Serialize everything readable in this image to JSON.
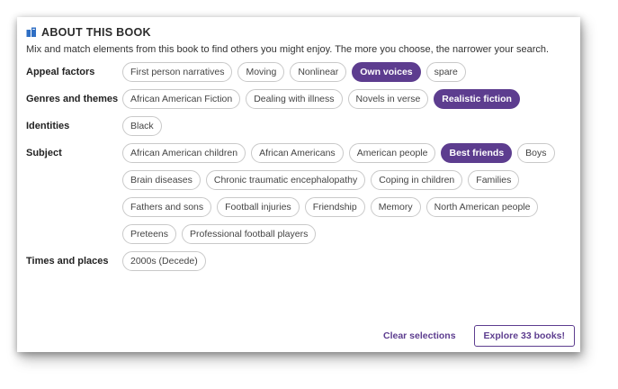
{
  "header": {
    "title": "ABOUT THIS BOOK",
    "icon": "book-icon",
    "intro": "Mix and match elements from this book to find others you might enjoy. The more you choose, the narrower your search."
  },
  "colors": {
    "accent": "#5d3d8f",
    "icon_blue": "#2f6fc4"
  },
  "sections": {
    "appeal": {
      "label": "Appeal factors",
      "chips": [
        {
          "label": "First person narratives",
          "selected": false
        },
        {
          "label": "Moving",
          "selected": false
        },
        {
          "label": "Nonlinear",
          "selected": false
        },
        {
          "label": "Own voices",
          "selected": true
        },
        {
          "label": "spare",
          "selected": false
        }
      ]
    },
    "genres": {
      "label": "Genres and themes",
      "chips": [
        {
          "label": "African American Fiction",
          "selected": false
        },
        {
          "label": "Dealing with illness",
          "selected": false
        },
        {
          "label": "Novels in verse",
          "selected": false
        },
        {
          "label": "Realistic fiction",
          "selected": true
        }
      ]
    },
    "identities": {
      "label": "Identities",
      "chips": [
        {
          "label": "Black",
          "selected": false
        }
      ]
    },
    "subject": {
      "label": "Subject",
      "chips": [
        {
          "label": "African American children",
          "selected": false
        },
        {
          "label": "African Americans",
          "selected": false
        },
        {
          "label": "American people",
          "selected": false
        },
        {
          "label": "Best friends",
          "selected": true
        },
        {
          "label": "Boys",
          "selected": false
        },
        {
          "label": "Brain diseases",
          "selected": false
        },
        {
          "label": "Chronic traumatic encephalopathy",
          "selected": false
        },
        {
          "label": "Coping in children",
          "selected": false
        },
        {
          "label": "Families",
          "selected": false
        },
        {
          "label": "Fathers and sons",
          "selected": false
        },
        {
          "label": "Football injuries",
          "selected": false
        },
        {
          "label": "Friendship",
          "selected": false
        },
        {
          "label": "Memory",
          "selected": false
        },
        {
          "label": "North American people",
          "selected": false
        },
        {
          "label": "Preteens",
          "selected": false
        },
        {
          "label": "Professional football players",
          "selected": false
        }
      ]
    },
    "times": {
      "label": "Times and places",
      "chips": [
        {
          "label": "2000s (Decede)",
          "selected": false
        }
      ]
    }
  },
  "footer": {
    "clear_label": "Clear selections",
    "explore_label": "Explore 33 books!"
  }
}
